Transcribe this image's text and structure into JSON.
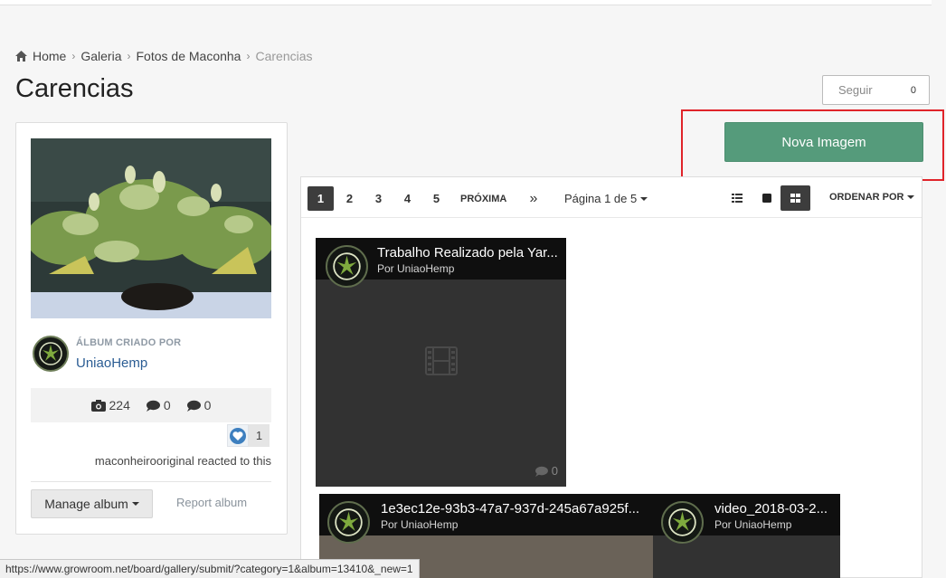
{
  "breadcrumb": {
    "items": [
      "Home",
      "Galeria",
      "Fotos de Maconha"
    ],
    "current": "Carencias"
  },
  "page": {
    "title": "Carencias"
  },
  "follow": {
    "label": "Seguir",
    "count": "0"
  },
  "actions": {
    "new_image": "Nova Imagem"
  },
  "album": {
    "created_by_label": "ÁLBUM CRIADO POR",
    "owner": "UniaoHemp",
    "stats": {
      "images": "224",
      "comments": "0",
      "reviews": "0"
    },
    "likes": "1",
    "reacted_text": "maconheirooriginal reacted to this",
    "manage_label": "Manage album",
    "report_label": "Report album"
  },
  "pagination": {
    "pages": [
      "1",
      "2",
      "3",
      "4",
      "5"
    ],
    "active_page": "1",
    "next_label": "PRÓXIMA",
    "last_label": "»",
    "page_info": "Página 1 de 5"
  },
  "view": {
    "sort_label": "ORDENAR POR",
    "active_view": "grid"
  },
  "images": [
    {
      "title": "Trabalho Realizado pela Yar...",
      "by": "Por UniaoHemp",
      "comments": "0"
    },
    {
      "title": "1e3ec12e-93b3-47a7-937d-245a67a925f...",
      "by": "Por UniaoHemp"
    },
    {
      "title": "video_2018-03-2...",
      "by": "Por UniaoHemp"
    }
  ],
  "status_bar": {
    "url": "https://www.growroom.net/board/gallery/submit/?category=1&album=13410&_new=1"
  },
  "colors": {
    "accent_green": "#559b7b",
    "link_blue": "#2b5d94",
    "highlight_red": "#e0242a"
  }
}
